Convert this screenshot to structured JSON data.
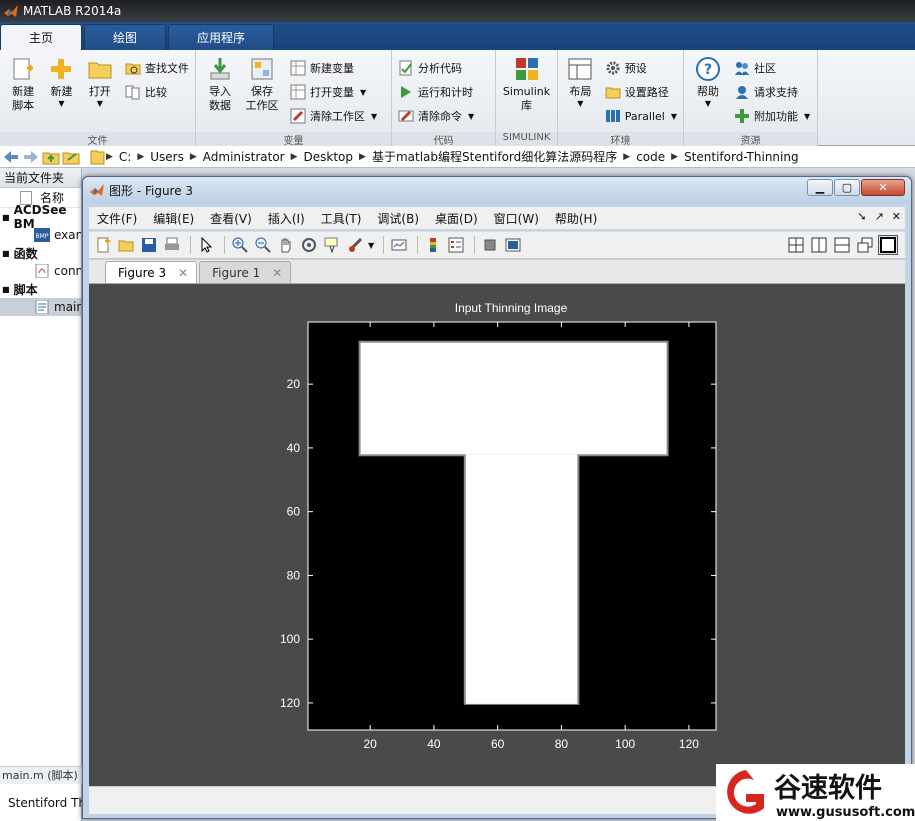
{
  "app": {
    "title": "MATLAB R2014a"
  },
  "ribbon": {
    "tabs": [
      {
        "label": "主页",
        "active": true
      },
      {
        "label": "绘图",
        "active": false
      },
      {
        "label": "应用程序",
        "active": false
      }
    ],
    "file": {
      "label": "文件",
      "new_script": "新建\n脚本",
      "new": "新建",
      "open": "打开",
      "find_files": "查找文件",
      "compare": "比较"
    },
    "variable": {
      "label": "变量",
      "import": "导入\n数据",
      "save_ws": "保存\n工作区",
      "new_var": "新建变量",
      "open_var": "打开变量",
      "clear_ws": "清除工作区"
    },
    "code": {
      "label": "代码",
      "analyze": "分析代码",
      "run_time": "运行和计时",
      "clear_cmds": "清除命令"
    },
    "simulink": {
      "label": "SIMULINK",
      "lib": "Simulink\n库"
    },
    "env": {
      "label": "环境",
      "layout": "布局",
      "prefs": "预设",
      "set_path": "设置路径",
      "parallel": "Parallel"
    },
    "resources": {
      "label": "资源",
      "help": "帮助",
      "community": "社区",
      "support": "请求支持",
      "addons": "附加功能"
    }
  },
  "address": {
    "crumbs": [
      "C:",
      "Users",
      "Administrator",
      "Desktop",
      "基于matlab编程Stentiford细化算法源码程序",
      "code",
      "Stentiford-Thinning"
    ]
  },
  "left_panel": {
    "title": "当前文件夹",
    "col_name": "名称",
    "groups": [
      {
        "label": "ACDSee BM",
        "items": [
          "exan"
        ]
      },
      {
        "label": "函数",
        "items": [
          "conn"
        ]
      },
      {
        "label": "脚本",
        "items": [
          "main"
        ]
      }
    ],
    "detail": "main.m (脚本)",
    "bottom_text": "Stentiford Th"
  },
  "figure": {
    "title": "图形 - Figure 3",
    "menu": [
      "文件(F)",
      "编辑(E)",
      "查看(V)",
      "插入(I)",
      "工具(T)",
      "调试(B)",
      "桌面(D)",
      "窗口(W)",
      "帮助(H)"
    ],
    "tabs": [
      {
        "label": "Figure 3",
        "active": true
      },
      {
        "label": "Figure 1",
        "active": false
      }
    ],
    "plot": {
      "title": "Input Thinning Image",
      "x_ticks": [
        "20",
        "40",
        "60",
        "80",
        "100",
        "120"
      ],
      "y_ticks": [
        "20",
        "40",
        "60",
        "80",
        "100",
        "120"
      ],
      "x_range": [
        0.5,
        128.5
      ],
      "y_range": [
        0.5,
        128.5
      ],
      "t_bar": {
        "x0": 17,
        "x1": 113,
        "y0": 7,
        "y1": 42
      },
      "t_stem": {
        "x0": 50,
        "x1": 85,
        "y0": 42,
        "y1": 120
      }
    }
  },
  "watermark": {
    "brand": "谷速软件",
    "url": "www.gususoft.com"
  }
}
